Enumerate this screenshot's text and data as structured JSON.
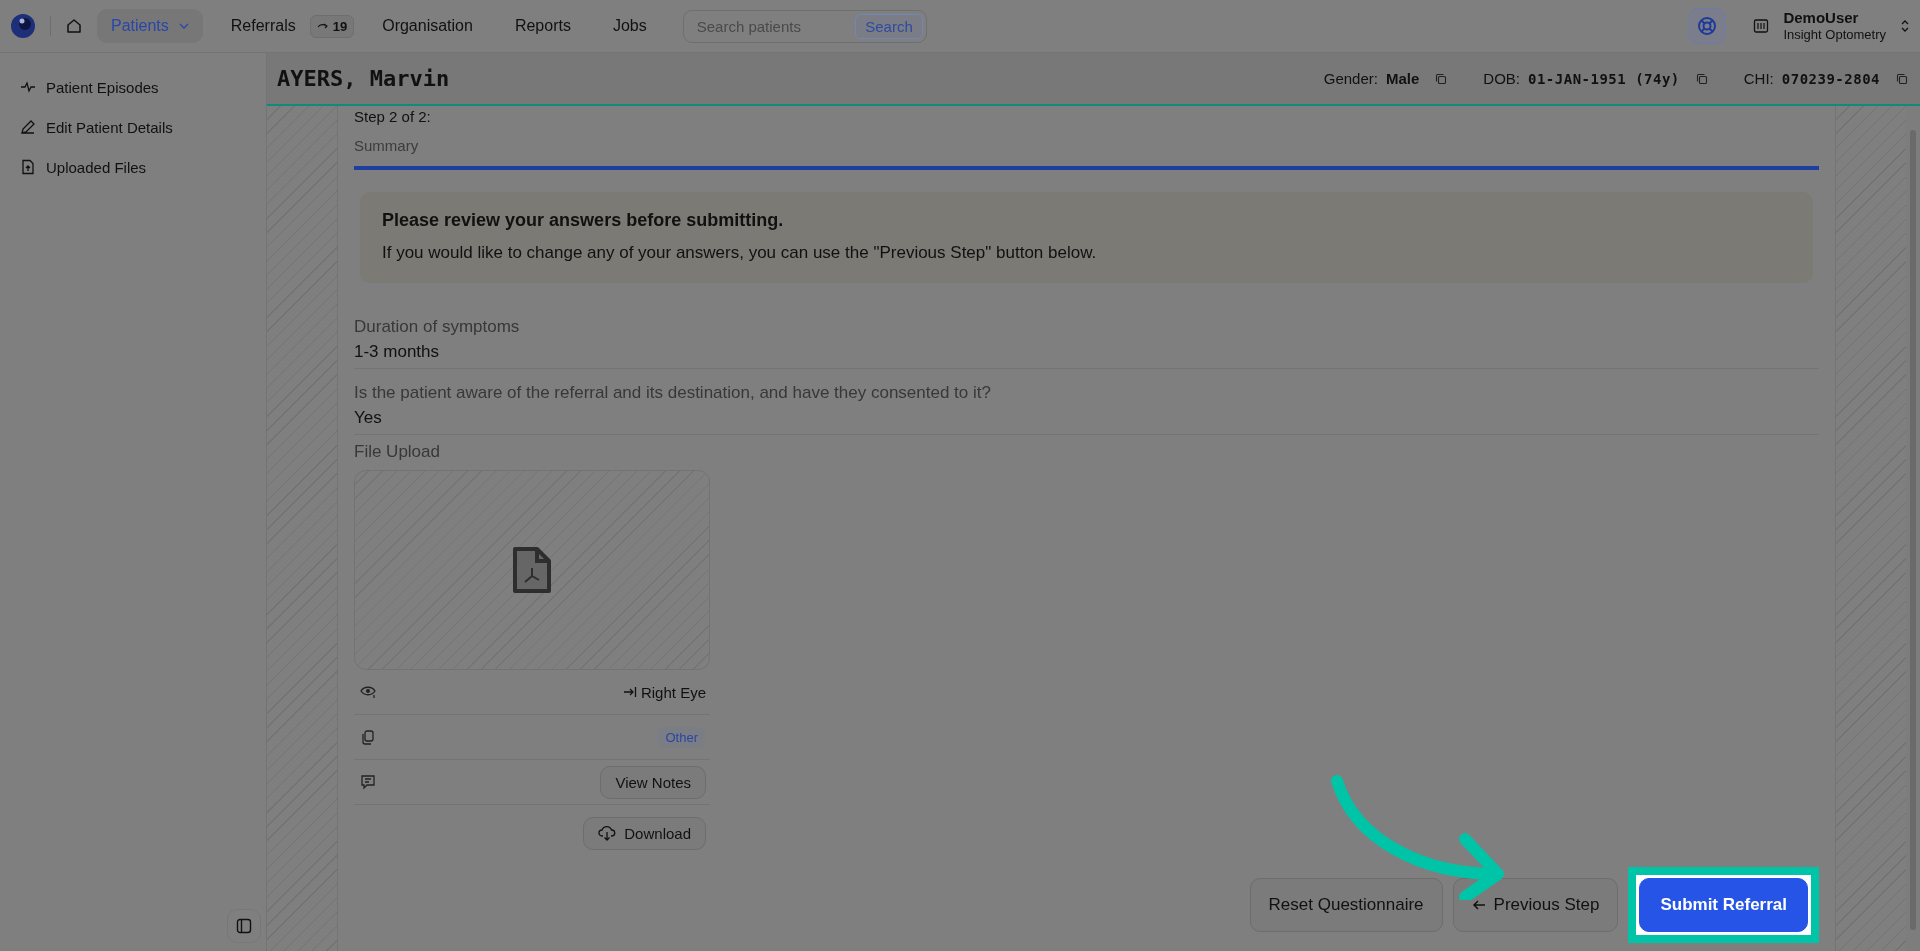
{
  "nav": {
    "items": [
      {
        "label": "Patients",
        "selected": true,
        "dropdown": true
      },
      {
        "label": "Referrals",
        "selected": false,
        "badge": "19"
      },
      {
        "label": "Organisation",
        "selected": false
      },
      {
        "label": "Reports",
        "selected": false
      },
      {
        "label": "Jobs",
        "selected": false
      }
    ],
    "search": {
      "placeholder": "Search patients",
      "button": "Search"
    },
    "user": {
      "name": "DemoUser",
      "organisation": "Insight Optometry"
    }
  },
  "sidebar": {
    "items": [
      {
        "label": "Patient Episodes"
      },
      {
        "label": "Edit Patient Details"
      },
      {
        "label": "Uploaded Files"
      }
    ]
  },
  "patient": {
    "name": "AYERS, Marvin",
    "fields": [
      {
        "label": "Gender:",
        "value": "Male"
      },
      {
        "label": "DOB:",
        "value": "01-JAN-1951 (74y)"
      },
      {
        "label": "CHI:",
        "value": "070239-2804"
      }
    ]
  },
  "step": {
    "label": "Step 2 of 2:",
    "title": "Summary",
    "level": 1
  },
  "notice": {
    "title": "Please review your answers before submitting.",
    "text": "If you would like to change any of your answers, you can use the \"Previous Step\" button below."
  },
  "answers": [
    {
      "question": "Duration of symptoms",
      "answer": "1-3 months"
    },
    {
      "question": "Is the patient aware of the referral and its destination, and have they consented to it?",
      "answer": "Yes"
    }
  ],
  "file_upload": {
    "label": "File Upload",
    "eye": "Right Eye",
    "tag": "Other",
    "notes_button": "View Notes",
    "download_button": "Download"
  },
  "buttons": [
    {
      "label": "Reset Questionnaire",
      "kind": "secondary",
      "highlighted": false
    },
    {
      "label": "Previous Step",
      "kind": "back",
      "highlighted": false
    },
    {
      "label": "Submit Referral",
      "kind": "primary",
      "highlighted": true
    }
  ]
}
